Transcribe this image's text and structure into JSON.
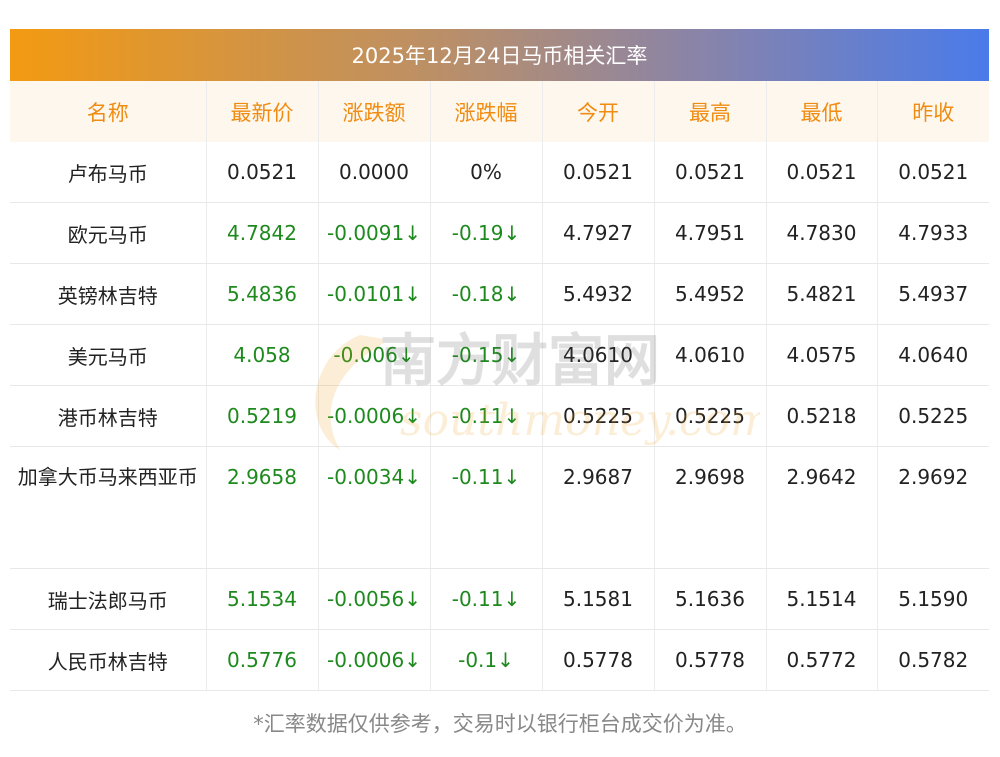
{
  "title": "2025年12月24日马币相关汇率",
  "columns": [
    "名称",
    "最新价",
    "涨跌额",
    "涨跌幅",
    "今开",
    "最高",
    "最低",
    "昨收"
  ],
  "rows": [
    {
      "name": "卢布马币",
      "latest": "0.0521",
      "change": "0.0000",
      "change_pct": "0%",
      "open": "0.0521",
      "high": "0.0521",
      "low": "0.0521",
      "prev_close": "0.0521",
      "direction": "flat"
    },
    {
      "name": "欧元马币",
      "latest": "4.7842",
      "change": "-0.0091↓",
      "change_pct": "-0.19↓",
      "open": "4.7927",
      "high": "4.7951",
      "low": "4.7830",
      "prev_close": "4.7933",
      "direction": "down"
    },
    {
      "name": "英镑林吉特",
      "latest": "5.4836",
      "change": "-0.0101↓",
      "change_pct": "-0.18↓",
      "open": "5.4932",
      "high": "5.4952",
      "low": "5.4821",
      "prev_close": "5.4937",
      "direction": "down"
    },
    {
      "name": "美元马币",
      "latest": "4.058",
      "change": "-0.006↓",
      "change_pct": "-0.15↓",
      "open": "4.0610",
      "high": "4.0610",
      "low": "4.0575",
      "prev_close": "4.0640",
      "direction": "down"
    },
    {
      "name": "港币林吉特",
      "latest": "0.5219",
      "change": "-0.0006↓",
      "change_pct": "-0.11↓",
      "open": "0.5225",
      "high": "0.5225",
      "low": "0.5218",
      "prev_close": "0.5225",
      "direction": "down"
    },
    {
      "name": "加拿大币马来西亚币",
      "latest": "2.9658",
      "change": "-0.0034↓",
      "change_pct": "-0.11↓",
      "open": "2.9687",
      "high": "2.9698",
      "low": "2.9642",
      "prev_close": "2.9692",
      "direction": "down"
    },
    {
      "name": "瑞士法郎马币",
      "latest": "5.1534",
      "change": "-0.0056↓",
      "change_pct": "-0.11↓",
      "open": "5.1581",
      "high": "5.1636",
      "low": "5.1514",
      "prev_close": "5.1590",
      "direction": "down"
    },
    {
      "name": "人民币林吉特",
      "latest": "0.5776",
      "change": "-0.0006↓",
      "change_pct": "-0.1↓",
      "open": "0.5778",
      "high": "0.5778",
      "low": "0.5772",
      "prev_close": "0.5782",
      "direction": "down"
    }
  ],
  "watermark": {
    "cn": "南方财富网",
    "en": "southmoney.com"
  },
  "footnote": "*汇率数据仅供参考，交易时以银行柜台成交价为准。",
  "colors": {
    "header_text": "#f08c12",
    "down": "#1e8a1e",
    "header_bg": "#fdf7ee"
  }
}
